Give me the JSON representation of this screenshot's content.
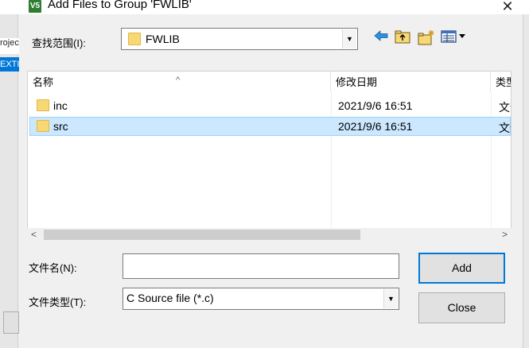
{
  "window": {
    "title": "Add Files to Group 'FWLIB'",
    "app_icon_text": "V5",
    "close_glyph": "✕"
  },
  "background": {
    "projec_text": "rojec",
    "exti_text": "EXTI"
  },
  "lookin": {
    "label": "查找范围(I):",
    "value": "FWLIB"
  },
  "toolbar": {
    "icons": [
      "back-icon",
      "up-folder-icon",
      "new-folder-icon",
      "view-menu-icon"
    ]
  },
  "list": {
    "columns": [
      {
        "label": "名称"
      },
      {
        "label": "修改日期"
      },
      {
        "label": "类型"
      }
    ],
    "rows": [
      {
        "name": "inc",
        "date": "2021/9/6 16:51",
        "type": "文件夹",
        "selected": false
      },
      {
        "name": "src",
        "date": "2021/9/6 16:51",
        "type": "文件夹",
        "selected": true
      }
    ]
  },
  "scrollbar": {
    "left_arrow": "<",
    "right_arrow": ">"
  },
  "filename": {
    "label": "文件名(N):",
    "value": ""
  },
  "filetype": {
    "label": "文件类型(T):",
    "value": "C Source file (*.c)"
  },
  "buttons": {
    "add": "Add",
    "close": "Close"
  },
  "colors": {
    "selection_bg": "#cce8ff",
    "selection_border": "#99d1ff",
    "folder": "#f8d775",
    "accent": "#0078d7"
  }
}
